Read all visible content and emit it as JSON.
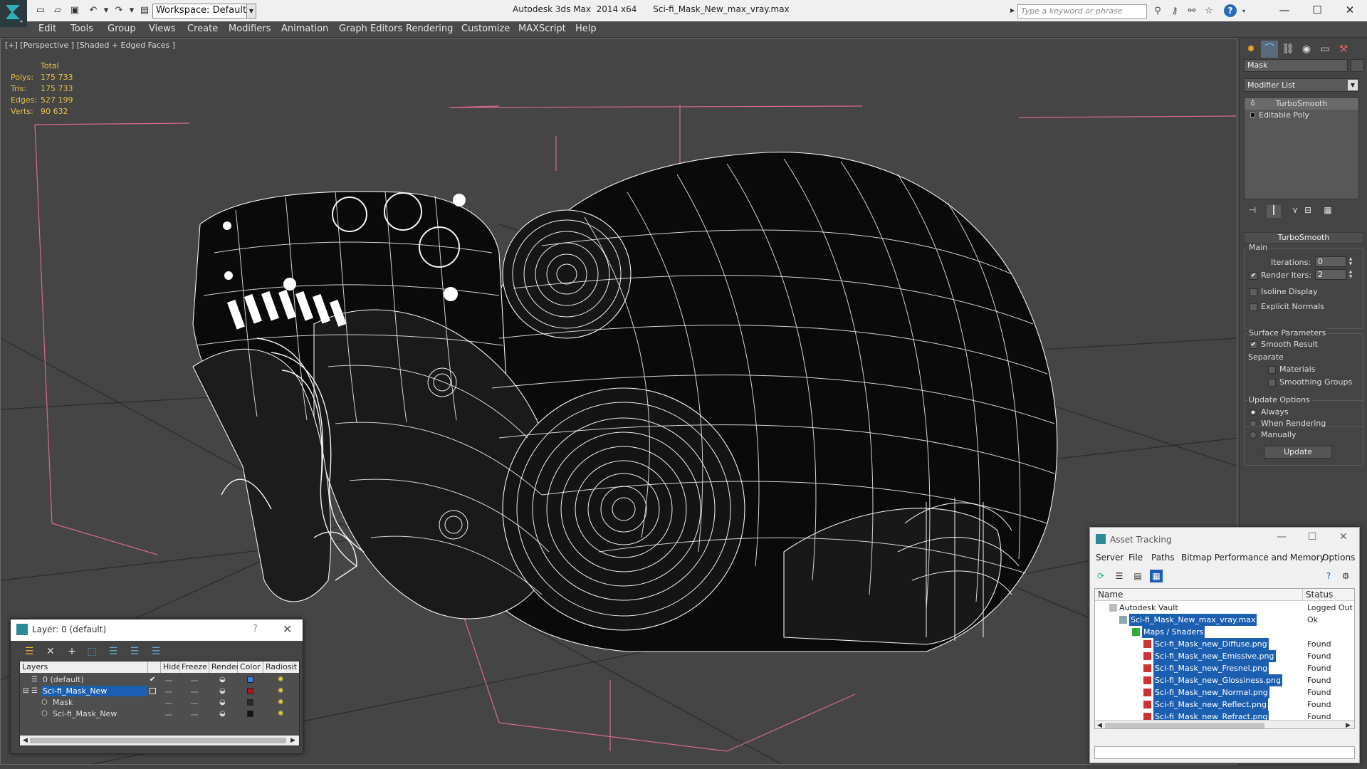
{
  "titlebar": {
    "app_name": "Autodesk 3ds Max  2014 x64",
    "file_name": "Sci-fi_Mask_New_max_vray.max",
    "workspace": "Workspace: Default",
    "search_placeholder": "Type a keyword or phrase"
  },
  "menu": [
    "Edit",
    "Tools",
    "Group",
    "Views",
    "Create",
    "Modifiers",
    "Animation",
    "Graph Editors",
    "Rendering",
    "Customize",
    "MAXScript",
    "Help"
  ],
  "viewport": {
    "label": "[+] [Perspective ] [Shaded + Edged Faces ]",
    "stats_header": "Total",
    "stats": [
      {
        "key": "Polys:",
        "value": "175 733"
      },
      {
        "key": "Tris:",
        "value": "175 733"
      },
      {
        "key": "Edges:",
        "value": "527 199"
      },
      {
        "key": "Verts:",
        "value": "90 632"
      }
    ]
  },
  "command_panel": {
    "object_name": "Mask",
    "modifier_list": "Modifier List",
    "stack": [
      "TurboSmooth",
      "Editable Poly"
    ],
    "rollout_title": "TurboSmooth",
    "main_group": "Main",
    "iterations_label": "Iterations:",
    "iterations_value": "0",
    "render_iters_label": "Render Iters:",
    "render_iters_value": "2",
    "isoline_display": "Isoline Display",
    "explicit_normals": "Explicit Normals",
    "surface_group": "Surface Parameters",
    "smooth_result": "Smooth Result",
    "separate_label": "Separate",
    "materials": "Materials",
    "smoothing_groups": "Smoothing Groups",
    "update_group": "Update Options",
    "always": "Always",
    "when_rendering": "When Rendering",
    "manually": "Manually",
    "update_button": "Update"
  },
  "layer_window": {
    "title": "Layer: 0 (default)",
    "columns": [
      "Layers",
      "Hide",
      "Freeze",
      "Render",
      "Color",
      "Radiosit"
    ],
    "rows": [
      {
        "name": "0 (default)",
        "color": "#3a7fd8"
      },
      {
        "name": "Sci-fi_Mask_New",
        "color": "#b01818"
      },
      {
        "name": "Mask",
        "color": "#2a2a2a"
      },
      {
        "name": "Sci-fi_Mask_New",
        "color": "#111111"
      }
    ]
  },
  "asset_tracking": {
    "title": "Asset Tracking",
    "menu": [
      "Server",
      "File",
      "Paths",
      "Bitmap Performance and Memory",
      "Options"
    ],
    "columns": [
      "Name",
      "Status"
    ],
    "rows": [
      {
        "name": "Autodesk Vault",
        "status": "Logged Out ."
      },
      {
        "name": "Sci-fi_Mask_New_max_vray.max",
        "status": "Ok"
      },
      {
        "name": "Maps / Shaders",
        "status": ""
      },
      {
        "name": "Sci-fi_Mask_new_Diffuse.png",
        "status": "Found"
      },
      {
        "name": "Sci-fi_Mask_new_Emissive.png",
        "status": "Found"
      },
      {
        "name": "Sci-fi_Mask_new_Fresnel.png",
        "status": "Found"
      },
      {
        "name": "Sci-fi_Mask_new_Glossiness.png",
        "status": "Found"
      },
      {
        "name": "Sci-fi_Mask_new_Normal.png",
        "status": "Found"
      },
      {
        "name": "Sci-fi_Mask_new_Reflect.png",
        "status": "Found"
      },
      {
        "name": "Sci-fi_Mask_new_Refract.png",
        "status": "Found"
      }
    ]
  }
}
